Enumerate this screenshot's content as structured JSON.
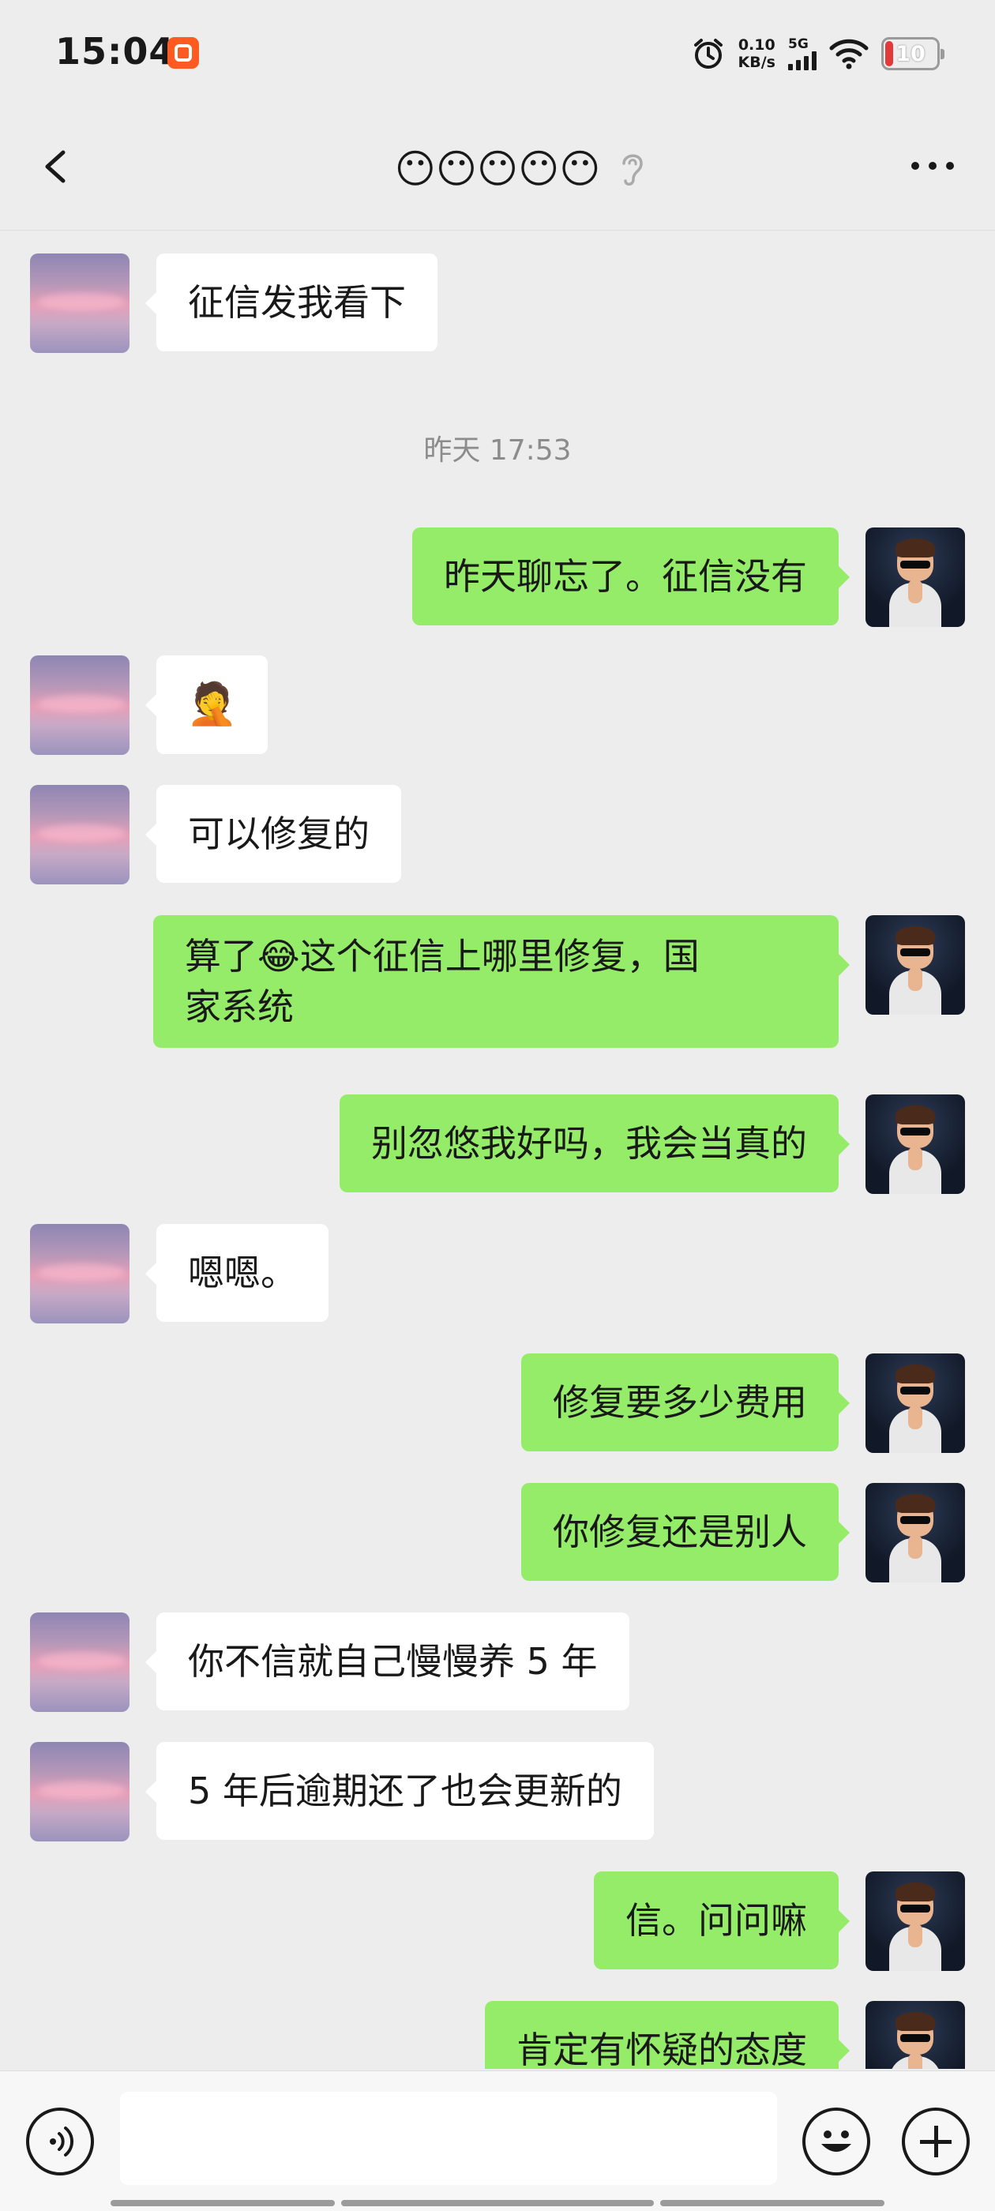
{
  "status_bar": {
    "time": "15:04",
    "network_speed_value": "0.10",
    "network_speed_unit": "KB/s",
    "network_type": "5G",
    "battery": "10",
    "icons": [
      "app-notification-icon",
      "alarm-icon",
      "signal-icon",
      "wifi-icon",
      "battery-icon"
    ]
  },
  "header": {
    "title_emojis": [
      "😶",
      "😶",
      "😶",
      "😶",
      "😶"
    ],
    "icons": [
      "back-icon",
      "ear-icon",
      "more-icon"
    ]
  },
  "messages": [
    {
      "from": "peer",
      "text": "征信发我看下"
    },
    {
      "type": "timestamp",
      "text": "昨天 17:53"
    },
    {
      "from": "me",
      "text": "昨天聊忘了。征信没有"
    },
    {
      "from": "peer",
      "text": "🤦"
    },
    {
      "from": "peer",
      "text": "可以修复的"
    },
    {
      "from": "me",
      "text_line1": "算了😂这个征信上哪里修复，国",
      "text_line2": "家系统"
    },
    {
      "from": "me",
      "text": "别忽悠我好吗，我会当真的"
    },
    {
      "from": "peer",
      "text": "嗯嗯。"
    },
    {
      "from": "me",
      "text": "修复要多少费用"
    },
    {
      "from": "me",
      "text": "你修复还是别人"
    },
    {
      "from": "peer",
      "text": "你不信就自己慢慢养 5 年"
    },
    {
      "from": "peer",
      "text": "5 年后逾期还了也会更新的"
    },
    {
      "from": "me",
      "text": "信。问问嘛"
    },
    {
      "from": "me",
      "text": "肯定有怀疑的态度"
    }
  ],
  "input_bar": {
    "placeholder": "",
    "icons": [
      "voice-icon",
      "emoji-icon",
      "plus-icon"
    ]
  },
  "colors": {
    "background": "#ededed",
    "my_bubble": "#95ec69",
    "peer_bubble": "#ffffff",
    "timestamp_text": "#8c8c8c"
  }
}
